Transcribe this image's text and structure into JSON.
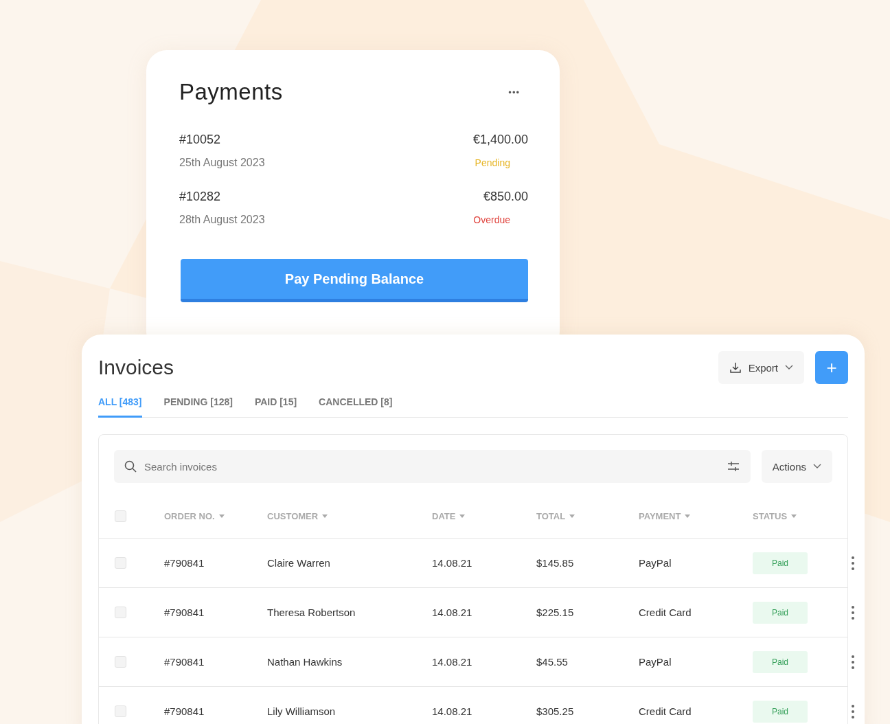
{
  "payments": {
    "title": "Payments",
    "menu": "•••",
    "items": [
      {
        "number": "#10052",
        "amount": "€1,400.00",
        "date": "25th August 2023",
        "status": "Pending",
        "color": "#e6b422"
      },
      {
        "number": "#10282",
        "amount": "€850.00",
        "date": "28th August 2023",
        "status": "Overdue",
        "color": "#e0443e"
      }
    ],
    "button": "Pay Pending Balance"
  },
  "invoices": {
    "title": "Invoices",
    "export": "Export",
    "add": "+",
    "tabs": [
      {
        "label": "ALL [483]",
        "selected": true
      },
      {
        "label": "PENDING [128]",
        "selected": false
      },
      {
        "label": "PAID [15]",
        "selected": false
      },
      {
        "label": "CANCELLED [8]",
        "selected": false
      }
    ],
    "search": {
      "placeholder": "Search invoices"
    },
    "actions": "Actions",
    "table": {
      "all_checked": false,
      "columns": [
        "ORDER NO.",
        "CUSTOMER",
        "DATE",
        "TOTAL",
        "PAYMENT",
        "STATUS"
      ],
      "rows": [
        {
          "checked": false,
          "cells": [
            "#790841",
            "Claire Warren",
            "14.08.21",
            "$145.85",
            "PayPal"
          ],
          "status": "Paid"
        },
        {
          "checked": false,
          "cells": [
            "#790841",
            "Theresa Robertson",
            "14.08.21",
            "$225.15",
            "Credit Card"
          ],
          "status": "Paid"
        },
        {
          "checked": false,
          "cells": [
            "#790841",
            "Nathan Hawkins",
            "14.08.21",
            "$45.55",
            "PayPal"
          ],
          "status": "Paid"
        },
        {
          "checked": false,
          "cells": [
            "#790841",
            "Lily Williamson",
            "14.08.21",
            "$305.25",
            "Credit Card"
          ],
          "status": "Paid"
        }
      ]
    }
  }
}
